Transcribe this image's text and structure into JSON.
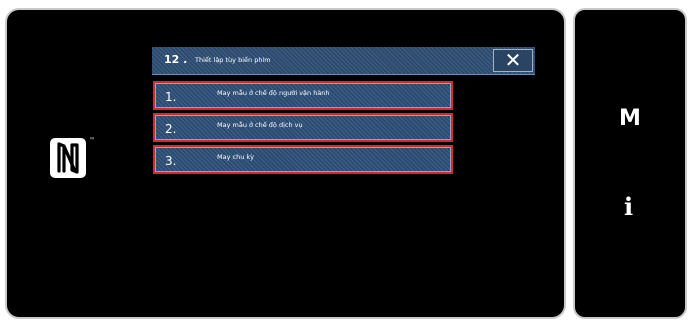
{
  "dialog": {
    "title_number": "12 .",
    "title_text": "Thiết lập tùy biến phím",
    "close_label": "✕"
  },
  "menu": {
    "items": [
      {
        "number": "1.",
        "label": "May mẫu ở chế độ người vận hành"
      },
      {
        "number": "2.",
        "label": "May mẫu ở chế độ dịch vụ"
      },
      {
        "number": "3.",
        "label": "May chu kỳ"
      }
    ]
  },
  "side_panel": {
    "mode_key": "M",
    "info_key": "i"
  },
  "nfc": {
    "icon": "nfc-icon",
    "trademark": "™"
  },
  "colors": {
    "highlight_border": "#d62a2a",
    "button_blue": "#2d4a6c",
    "screen_background": "#000000"
  }
}
